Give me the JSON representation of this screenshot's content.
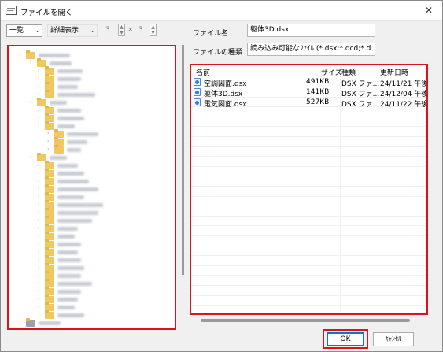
{
  "window": {
    "title": "ファイルを開く",
    "close_glyph": "✕"
  },
  "toolbar": {
    "view_mode": "一覧",
    "detail_mode": "詳細表示",
    "cols": "3",
    "times": "×",
    "rows": "3"
  },
  "filename": {
    "label": "ファイル名",
    "value": "躯体3D.dsx"
  },
  "filetype": {
    "label": "ファイルの種類",
    "value": "読み込み可能なﾌｧｲﾙ (*.dsx;*.dcd;*.d"
  },
  "list": {
    "headers": {
      "name": "名前",
      "size": "サイズ",
      "type": "種類",
      "date": "更新日時"
    },
    "rows": [
      {
        "name": "空調図面.dsx",
        "size": "491KB",
        "type": "DSX ファ...",
        "date": "24/11/21 午後"
      },
      {
        "name": "躯体3D.dsx",
        "size": "141KB",
        "type": "DSX ファ...",
        "date": "24/12/04 午後"
      },
      {
        "name": "電気図面.dsx",
        "size": "527KB",
        "type": "DSX ファ...",
        "date": "24/11/22 午後"
      }
    ]
  },
  "buttons": {
    "ok": "OK",
    "cancel": "ｷｬﾝｾﾙ"
  },
  "colors": {
    "highlight": "#d9141e",
    "folder": "#f1c761",
    "focus": "#0078d4"
  },
  "icons": [
    "app-icon",
    "close-icon",
    "folder-icon",
    "dsx-file-icon"
  ]
}
